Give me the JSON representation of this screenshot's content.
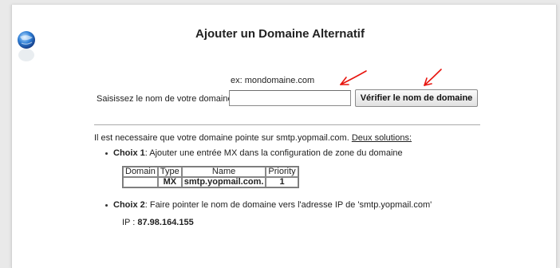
{
  "form": {
    "title": "Ajouter un Domaine Alternatif",
    "example_hint": "ex: mondomaine.com",
    "domain_label": "Saisissez le nom de votre domaine",
    "domain_value": "",
    "check_button": "Vérifier le nom de domaine"
  },
  "instructions": {
    "intro": "Il est necessaire que votre domaine pointe sur smtp.yopmail.com. ",
    "solutions_link": "Deux solutions:",
    "choice1_label": "Choix 1",
    "choice1_text": ": Ajouter une entrée MX dans la configuration de zone du domaine",
    "mx_table": {
      "headers": [
        "Domain",
        "Type",
        "Name",
        "Priority"
      ],
      "row": [
        "",
        "MX",
        "smtp.yopmail.com.",
        "1"
      ]
    },
    "choice2_label": "Choix 2",
    "choice2_text": ": Faire pointer le nom de domaine vers l'adresse IP de 'smtp.yopmail.com'",
    "ip_label": "IP : ",
    "ip_value": "87.98.164.155"
  },
  "colors": {
    "annotation_arrows": "#e8150f",
    "logo_blue": "#2f7fd6"
  },
  "icons": {
    "logo": "globe-logo-icon",
    "annotations": "red-arrow-icon"
  }
}
